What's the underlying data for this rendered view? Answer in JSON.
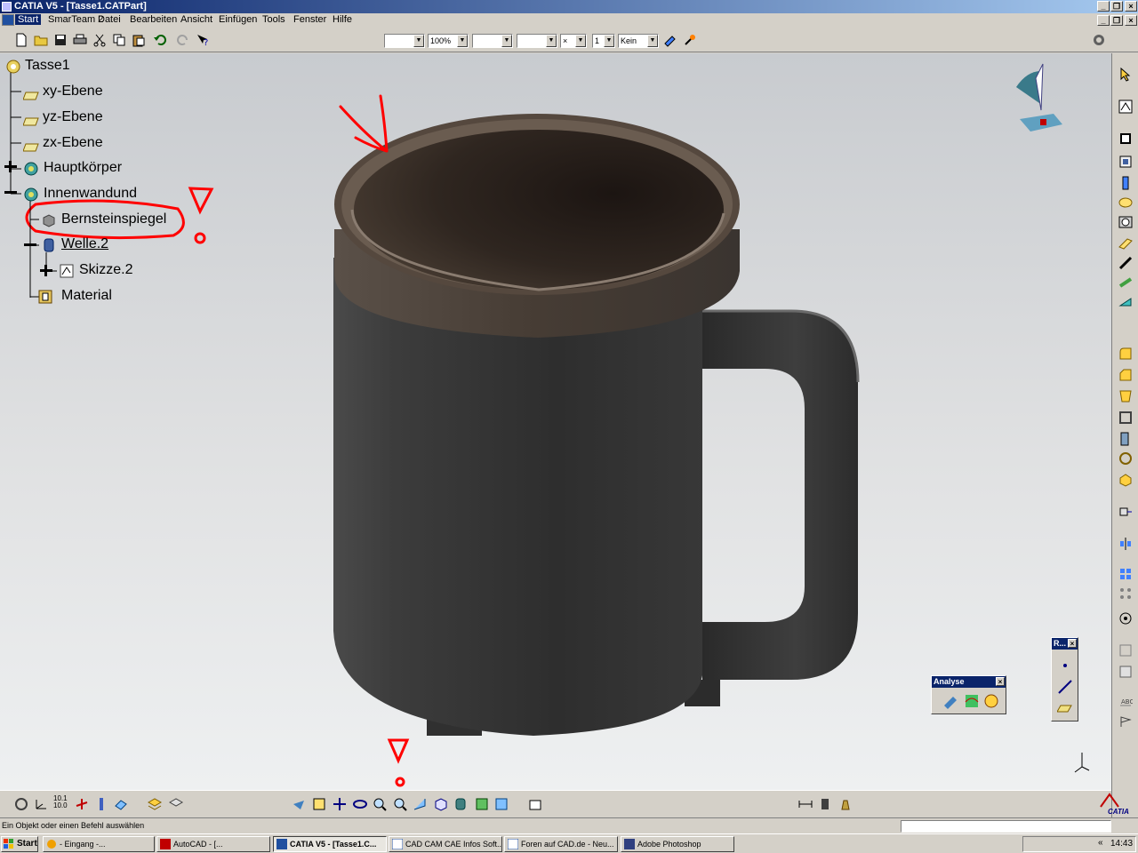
{
  "window": {
    "title": "CATIA V5 - [Tasse1.CATPart]",
    "min_symbol": "_",
    "restore_symbol": "❐",
    "close_symbol": "×"
  },
  "menu": [
    {
      "label": "Start"
    },
    {
      "label": "SmarTeam 2"
    },
    {
      "label": "Datei"
    },
    {
      "label": "Bearbeiten"
    },
    {
      "label": "Ansicht"
    },
    {
      "label": "Einfügen"
    },
    {
      "label": "Tools"
    },
    {
      "label": "Fenster"
    },
    {
      "label": "Hilfe"
    }
  ],
  "toolbar": {
    "zoom_value": "100%",
    "layer_value": "Kein",
    "weight_value": "×",
    "number_value": "1"
  },
  "tree": {
    "root": "Tasse1",
    "items": [
      {
        "label": "xy-Ebene"
      },
      {
        "label": "yz-Ebene"
      },
      {
        "label": "zx-Ebene"
      },
      {
        "label": "Hauptkörper"
      },
      {
        "label": "Innenwandund"
      },
      {
        "label": "Bernsteinspiegel"
      },
      {
        "label": "Welle.2"
      },
      {
        "label": "Skizze.2"
      },
      {
        "label": "Material"
      }
    ]
  },
  "palettes": {
    "analyse_title": "Analyse",
    "r_title": "R..."
  },
  "status": {
    "message": "Ein Objekt oder einen Befehl auswählen"
  },
  "bottom_toolbar": {
    "grid_label_top": "10.1",
    "grid_label_bottom": "10.0"
  },
  "logo": {
    "text": "CATIA"
  },
  "taskbar": {
    "start_label": "Start",
    "tasks": [
      {
        "label": "- Eingang -..."
      },
      {
        "label": "AutoCAD - [..."
      },
      {
        "label": "CATIA V5 - [Tasse1.C..."
      },
      {
        "label": "CAD CAM CAE Infos Soft..."
      },
      {
        "label": "Foren auf CAD.de - Neu..."
      },
      {
        "label": "Adobe Photoshop"
      }
    ],
    "clock": "14:43",
    "tray_arrow": "«"
  },
  "colors": {
    "title_gradient_start": "#0a246a",
    "annotation_red": "#ff0000",
    "mug_body": "#3a3a3a",
    "mug_rim": "#4a423a"
  }
}
